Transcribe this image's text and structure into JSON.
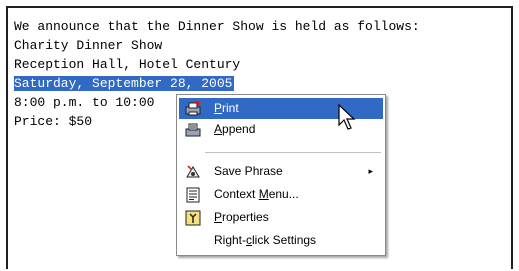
{
  "document": {
    "lines": [
      "We announce that the Dinner Show is held as follows:",
      "Charity Dinner Show",
      "Reception Hall, Hotel Century",
      "Saturday, September 28, 2005",
      "8:00 p.m. to 10:00",
      "Price: $50"
    ]
  },
  "context_menu": {
    "items": [
      {
        "label_pre": "",
        "mnemonic": "P",
        "label_post": "rint",
        "icon": "print-icon",
        "highlighted": true
      },
      {
        "label_pre": "",
        "mnemonic": "A",
        "label_post": "ppend",
        "icon": "append-icon"
      },
      {
        "label_pre": "Save Phrase",
        "mnemonic": "",
        "label_post": "",
        "icon": "save-phrase-icon",
        "submenu": "▸"
      },
      {
        "label_pre": "Context ",
        "mnemonic": "M",
        "label_post": "enu...",
        "icon": "context-menu-icon"
      },
      {
        "label_pre": "",
        "mnemonic": "P",
        "label_post": "roperties",
        "icon": "properties-icon"
      },
      {
        "label_pre": "Right-",
        "mnemonic": "c",
        "label_post": "lick Settings",
        "icon": ""
      }
    ]
  },
  "colors": {
    "selection": "#316ac5"
  }
}
